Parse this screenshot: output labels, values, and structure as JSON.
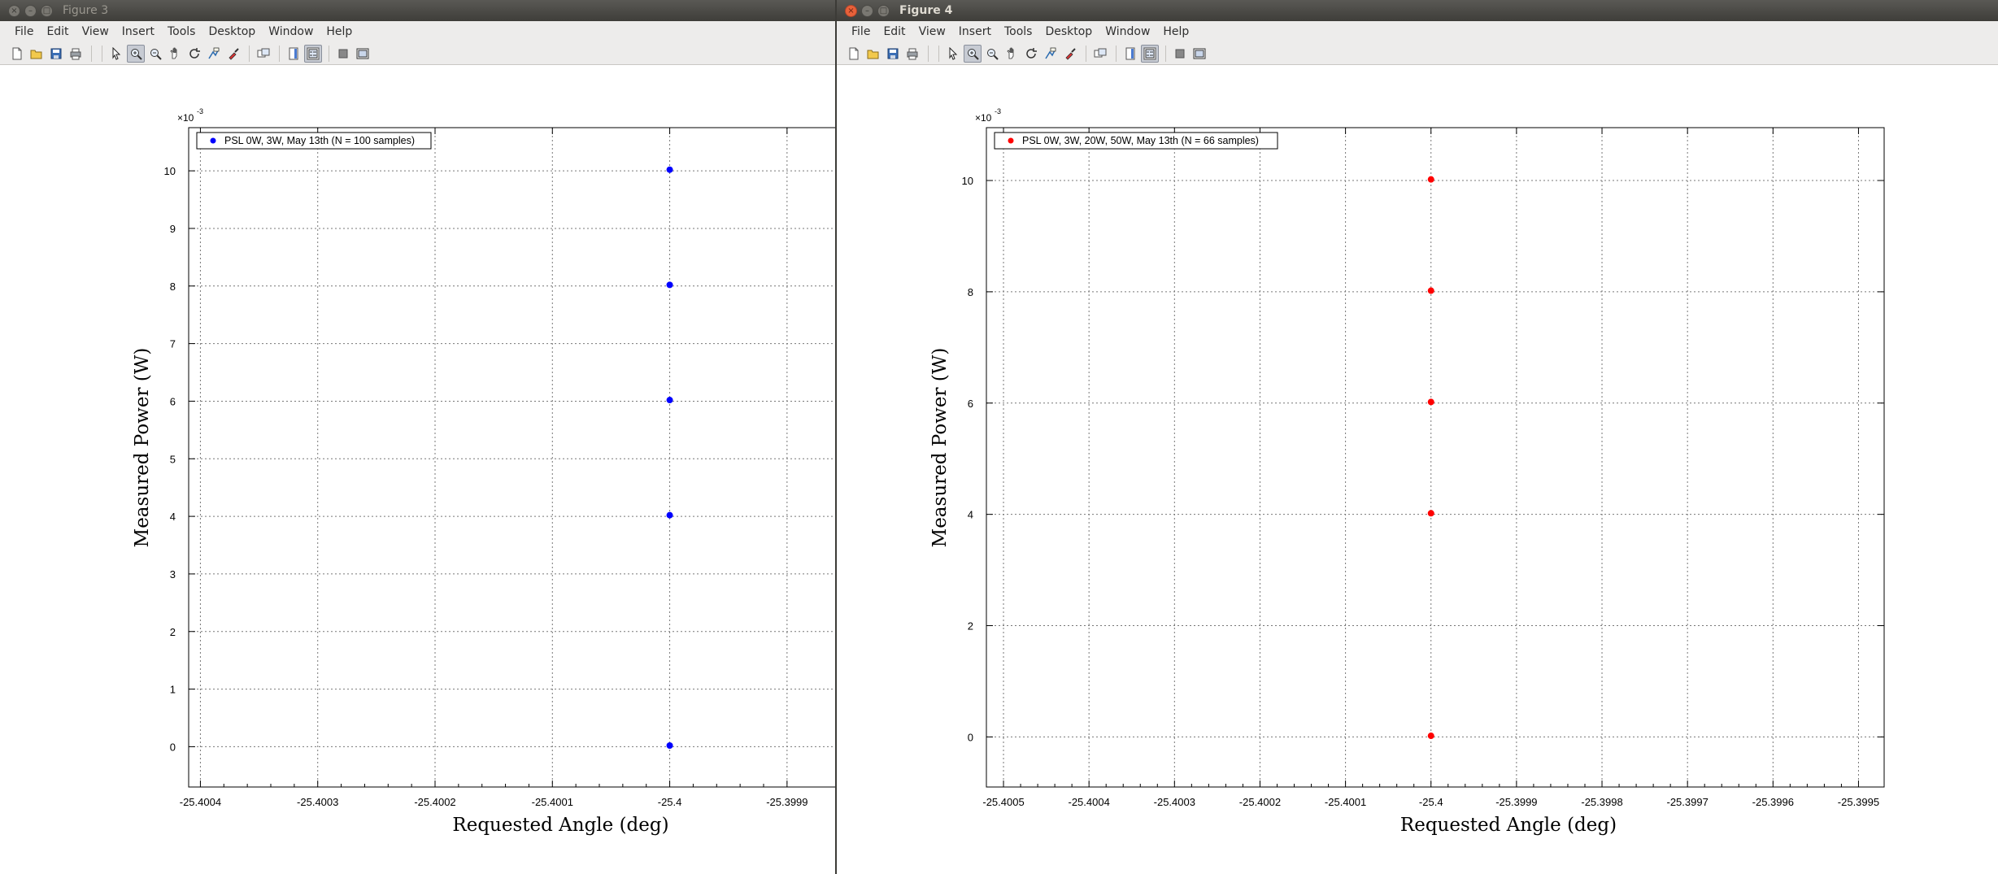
{
  "windows": [
    {
      "id": "win3",
      "title": "Figure 3",
      "active": false,
      "menu": [
        "File",
        "Edit",
        "View",
        "Insert",
        "Tools",
        "Desktop",
        "Window",
        "Help"
      ],
      "toolbar_icons": [
        "new-file-icon",
        "open-file-icon",
        "save-icon",
        "print-icon",
        "pointer-icon",
        "zoom-in-icon",
        "zoom-out-icon",
        "pan-icon",
        "rotate-icon",
        "data-cursor-icon",
        "brush-icon",
        "link-plot-icon",
        "colorbar-icon",
        "legend-icon",
        "hide-tools-icon",
        "show-tools-icon"
      ],
      "chart_data": {
        "type": "scatter",
        "xlabel": "Requested Angle (deg)",
        "ylabel": "Measured Power (W)",
        "exponent_label": "×10",
        "exponent_power": "-3",
        "x_ticks": [
          -25.4004,
          -25.4003,
          -25.4002,
          -25.4001,
          -25.4,
          -25.3999
        ],
        "x_tick_labels": [
          "-25.4004",
          "-25.4003",
          "-25.4002",
          "-25.4001",
          "-25.4",
          "-25.3999"
        ],
        "y_ticks": [
          0,
          1,
          2,
          3,
          4,
          5,
          6,
          7,
          8,
          9,
          10
        ],
        "y_tick_labels": [
          "0",
          "1",
          "2",
          "3",
          "4",
          "5",
          "6",
          "7",
          "8",
          "9",
          "10"
        ],
        "xlim": [
          -25.40041,
          -25.39985
        ],
        "ylim": [
          -0.7,
          10.75
        ],
        "grid": true,
        "legend_position": "top-left",
        "series": [
          {
            "name": "PSL 0W, 3W, May 13th (N = 100 samples)",
            "color": "#0000ff",
            "points": [
              {
                "x": -25.4,
                "y": 0.02
              },
              {
                "x": -25.4,
                "y": 4.02
              },
              {
                "x": -25.4,
                "y": 6.02
              },
              {
                "x": -25.4,
                "y": 8.02
              },
              {
                "x": -25.4,
                "y": 10.02
              }
            ]
          }
        ]
      }
    },
    {
      "id": "win4",
      "title": "Figure 4",
      "active": true,
      "menu": [
        "File",
        "Edit",
        "View",
        "Insert",
        "Tools",
        "Desktop",
        "Window",
        "Help"
      ],
      "toolbar_icons": [
        "new-file-icon",
        "open-file-icon",
        "save-icon",
        "print-icon",
        "pointer-icon",
        "zoom-in-icon",
        "zoom-out-icon",
        "pan-icon",
        "rotate-icon",
        "data-cursor-icon",
        "brush-icon",
        "link-plot-icon",
        "colorbar-icon",
        "legend-icon",
        "hide-tools-icon",
        "show-tools-icon"
      ],
      "chart_data": {
        "type": "scatter",
        "xlabel": "Requested Angle (deg)",
        "ylabel": "Measured Power (W)",
        "exponent_label": "×10",
        "exponent_power": "-3",
        "x_ticks": [
          -25.4005,
          -25.4004,
          -25.4003,
          -25.4002,
          -25.4001,
          -25.4,
          -25.3999,
          -25.3998,
          -25.3997,
          -25.3996,
          -25.3995
        ],
        "x_tick_labels": [
          "-25.4005",
          "-25.4004",
          "-25.4003",
          "-25.4002",
          "-25.4001",
          "-25.4",
          "-25.3999",
          "-25.3998",
          "-25.3997",
          "-25.3996",
          "-25.3995"
        ],
        "y_ticks": [
          0,
          2,
          4,
          6,
          8,
          10
        ],
        "y_tick_labels": [
          "0",
          "2",
          "4",
          "6",
          "8",
          "10"
        ],
        "xlim": [
          -25.40052,
          -25.39947
        ],
        "ylim": [
          -0.9,
          10.95
        ],
        "grid": true,
        "legend_position": "top-left",
        "series": [
          {
            "name": "PSL 0W, 3W, 20W, 50W, May 13th (N = 66 samples)",
            "color": "#ff0000",
            "points": [
              {
                "x": -25.4,
                "y": 0.02
              },
              {
                "x": -25.4,
                "y": 4.02
              },
              {
                "x": -25.4,
                "y": 6.02
              },
              {
                "x": -25.4,
                "y": 8.02
              },
              {
                "x": -25.4,
                "y": 10.02
              }
            ]
          }
        ]
      }
    }
  ]
}
